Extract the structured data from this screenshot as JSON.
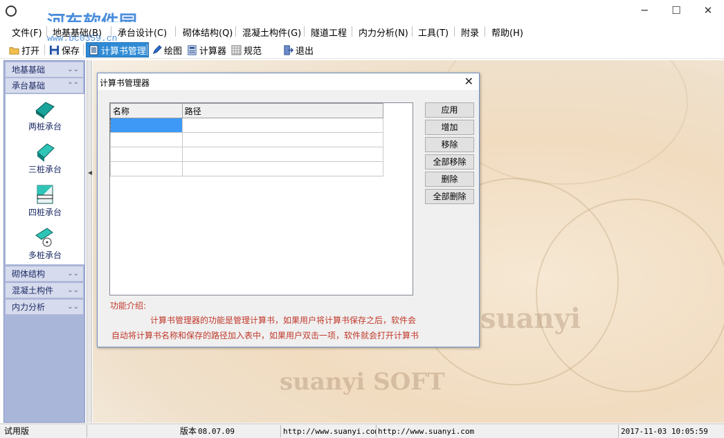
{
  "window": {
    "title": "",
    "minimize": "─",
    "maximize": "☐",
    "close": "✕"
  },
  "watermark": {
    "brand": "河东软件园",
    "url": "www.pc0359.cn"
  },
  "menu": [
    {
      "label": "文件(F)"
    },
    {
      "label": "地基基础(B)"
    },
    {
      "label": "承台设计(C)"
    },
    {
      "label": "砌体结构(Q)"
    },
    {
      "label": "混凝土构件(G)"
    },
    {
      "label": "隧道工程"
    },
    {
      "label": "内力分析(N)"
    },
    {
      "label": "工具(T)"
    },
    {
      "label": "附录"
    },
    {
      "label": "帮助(H)"
    }
  ],
  "toolbar": {
    "open": "打开",
    "save": "保存",
    "calc_manager": "计算书管理",
    "draw": "绘图",
    "calculator": "计算器",
    "spec": "规范",
    "exit": "退出"
  },
  "sidebar": {
    "groups": [
      "地基基础",
      "承台基础",
      "砌体结构",
      "混凝土构件",
      "内力分析"
    ],
    "tools": [
      "两桩承台",
      "三桩承台",
      "四桩承台",
      "多桩承台"
    ]
  },
  "background": {
    "word1": "suanyi",
    "word2": "suanyi SOFT"
  },
  "dialog": {
    "title": "计算书管理器",
    "columns": [
      "名称",
      "路径"
    ],
    "rows": [
      [
        "",
        ""
      ],
      [
        "",
        ""
      ],
      [
        "",
        ""
      ],
      [
        "",
        ""
      ]
    ],
    "buttons": [
      "应用",
      "增加",
      "移除",
      "全部移除",
      "删除",
      "全部删除"
    ],
    "intro_label": "功能介绍:",
    "intro_line1": "计算书管理器的功能是管理计算书，如果用户将计算书保存之后，软件会",
    "intro_line2": "自动将计算书名称和保存的路径加入表中，如果用户双击一项，软件就会打开计算书"
  },
  "status": {
    "edition": "试用版",
    "version_label": "版本",
    "version": "08.07.09",
    "url1": "http://www.suanyi.com",
    "url2": "http://www.suanyi.com",
    "datetime": "2017-11-03 10:05:59"
  },
  "colors": {
    "sidebar_bg": "#a9b5d9",
    "selection": "#3d99f5",
    "intro_text": "#c0392b",
    "active_tool": "#2f8bd6"
  }
}
